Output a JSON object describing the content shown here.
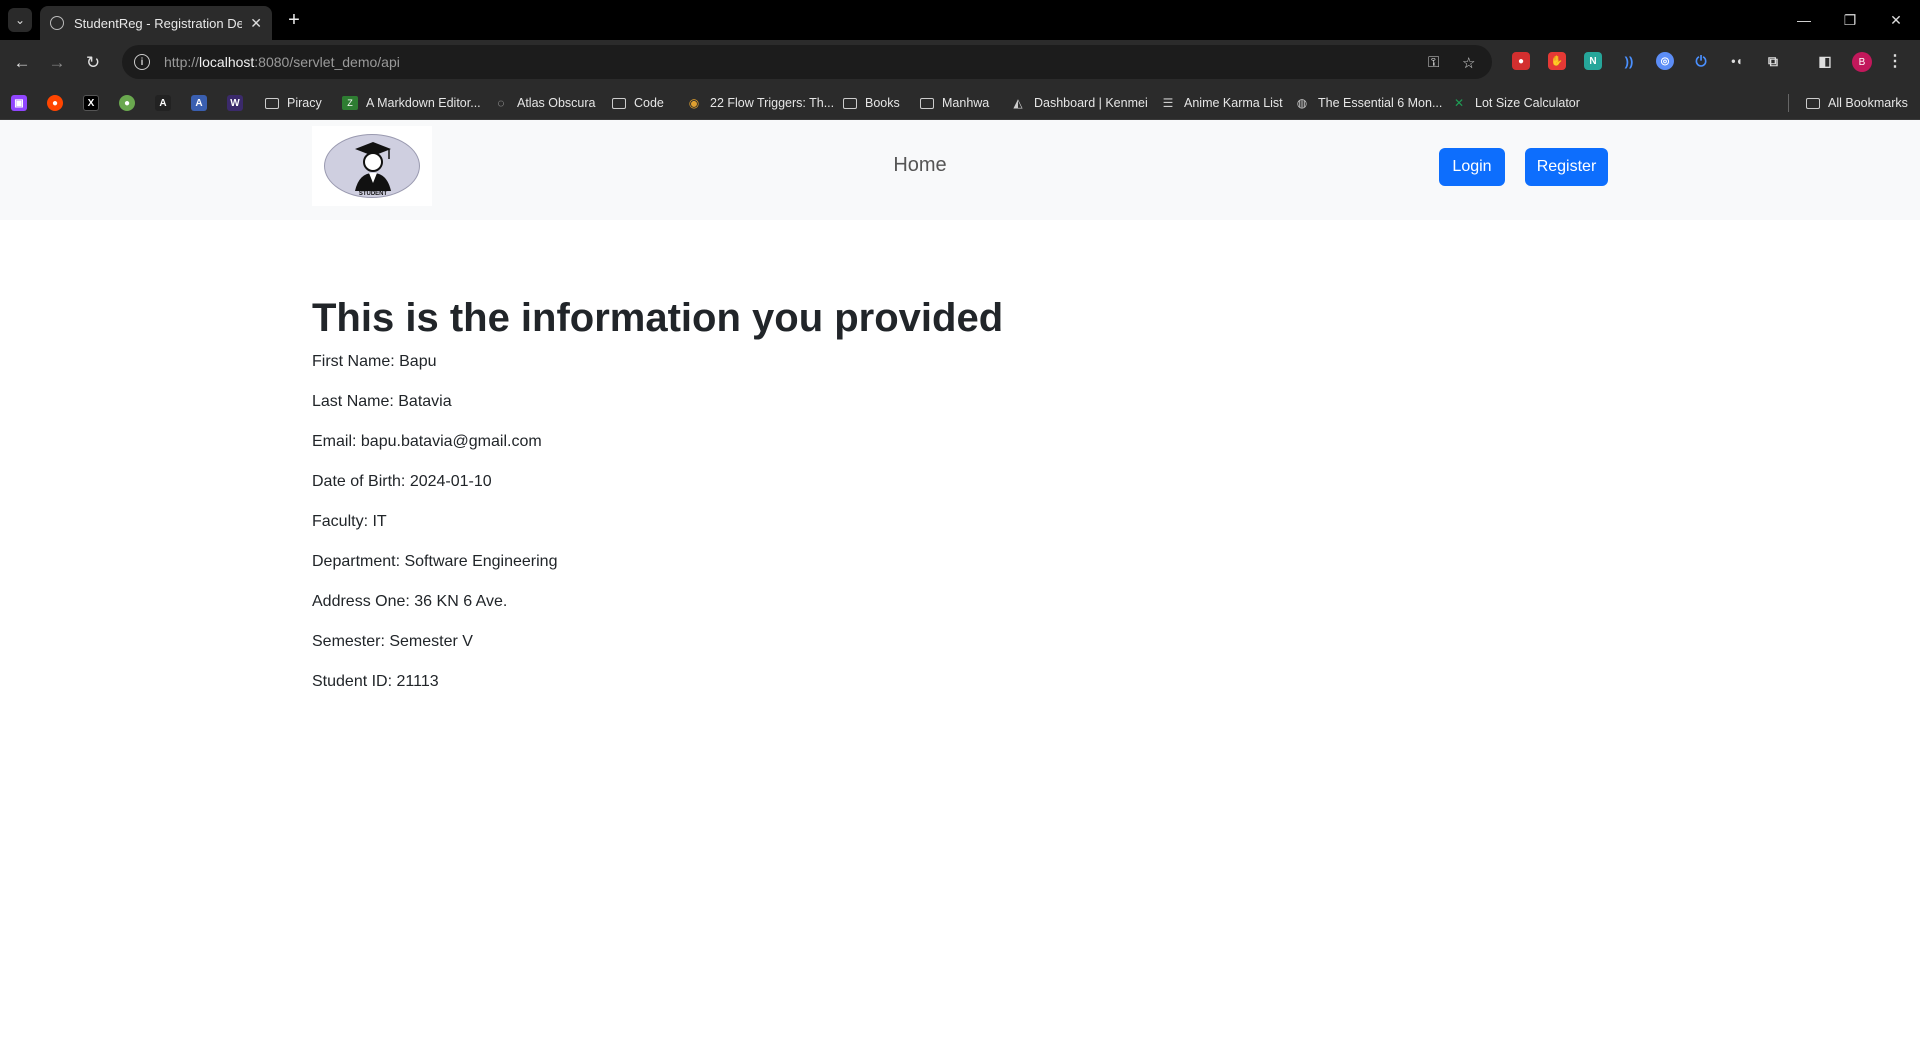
{
  "browser": {
    "tab_title": "StudentReg - Registration Deta",
    "new_tab_icon": "plus-icon",
    "url_scheme": "http://",
    "url_host": "localhost",
    "url_rest": ":8080/servlet_demo/api",
    "bookmarks": [
      {
        "label": "Piracy",
        "type": "folder"
      },
      {
        "label": "A Markdown Editor...",
        "type": "site"
      },
      {
        "label": "Atlas Obscura",
        "type": "site"
      },
      {
        "label": "Code",
        "type": "folder"
      },
      {
        "label": "22 Flow Triggers: Th...",
        "type": "site"
      },
      {
        "label": "Books",
        "type": "folder"
      },
      {
        "label": "Manhwa",
        "type": "folder"
      },
      {
        "label": "Dashboard | Kenmei",
        "type": "site"
      },
      {
        "label": "Anime Karma List",
        "type": "site"
      },
      {
        "label": "The Essential 6 Mon...",
        "type": "site"
      },
      {
        "label": "Lot Size Calculator",
        "type": "site"
      }
    ],
    "all_bookmarks": "All Bookmarks",
    "profile_initial": "B",
    "logo_caption": "STUDENT"
  },
  "nav": {
    "home": "Home",
    "login": "Login",
    "register": "Register"
  },
  "details": {
    "heading": "This is the information you provided",
    "first_name": "First Name: Bapu",
    "last_name": "Last Name: Batavia",
    "email": "Email: bapu.batavia@gmail.com",
    "dob": "Date of Birth: 2024-01-10",
    "faculty": "Faculty: IT",
    "department": "Department: Software Engineering",
    "address": "Address One: 36 KN 6 Ave.",
    "semester": "Semester: Semester V",
    "student_id": "Student ID: 21113"
  },
  "colors": {
    "primary": "#0d6efd",
    "navbar_bg": "#f8f9fa",
    "chrome_bg": "#2b2b2b"
  }
}
